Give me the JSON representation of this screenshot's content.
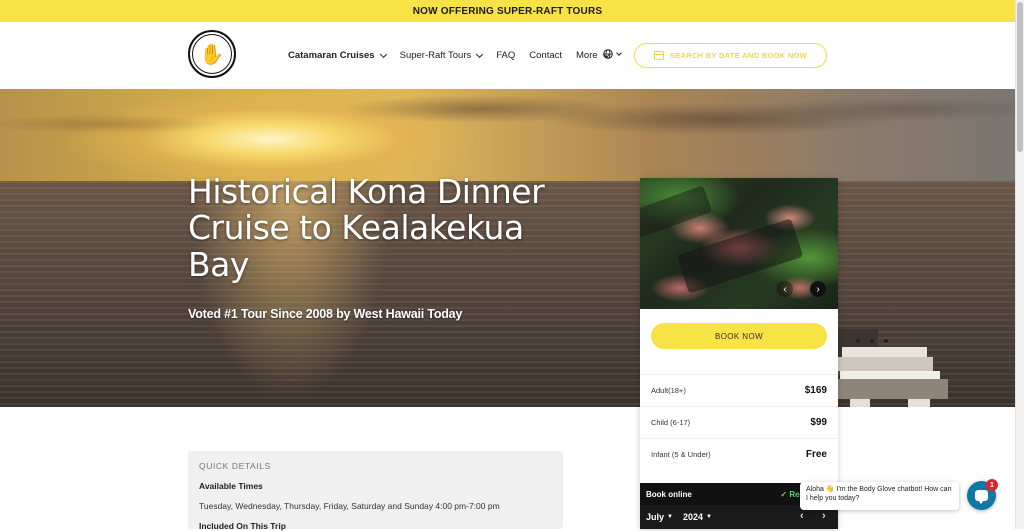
{
  "announcement": {
    "text": "NOW OFFERING SUPER-RAFT TOURS"
  },
  "header": {
    "logo_icon": "hand-logo-icon",
    "nav": [
      {
        "label": "Catamaran Cruises",
        "has_dropdown": true
      },
      {
        "label": "Super-Raft Tours",
        "has_dropdown": true
      },
      {
        "label": "FAQ",
        "has_dropdown": false
      },
      {
        "label": "Contact",
        "has_dropdown": false
      },
      {
        "label": "More",
        "has_dropdown": true
      }
    ],
    "language_icon": "globe-icon",
    "search_cta": "SEARCH BY DATE AND BOOK NOW"
  },
  "hero": {
    "title": "Historical Kona Dinner Cruise to Kealakekua Bay",
    "subtitle": "Voted #1 Tour Since 2008 by West Hawaii Today"
  },
  "booking": {
    "book_label": "BOOK NOW",
    "prices": [
      {
        "label": "Adult(18+)",
        "value": "$169"
      },
      {
        "label": "Child (6-17)",
        "value": "$99"
      },
      {
        "label": "Infant (5 & Under)",
        "value": "Free"
      }
    ],
    "book_online": "Book online",
    "realtime": "✓ Real-time a",
    "month": "July",
    "year": "2024"
  },
  "quick_details": {
    "title": "QUICK DETAILS",
    "times_label": "Available Times",
    "times": "Tuesday, Wednesday, Thursday, Friday,  Saturday and Sunday 4:00 pm-7:00 pm",
    "included_label": "Included On This Trip"
  },
  "chat": {
    "message": "Aloha 👋 I'm the Body Glove chatbot! How can I help you today?",
    "badge": "1"
  },
  "colors": {
    "accent_yellow": "#f7e345",
    "chat_blue": "#1178a6",
    "badge_red": "#d9252b"
  }
}
